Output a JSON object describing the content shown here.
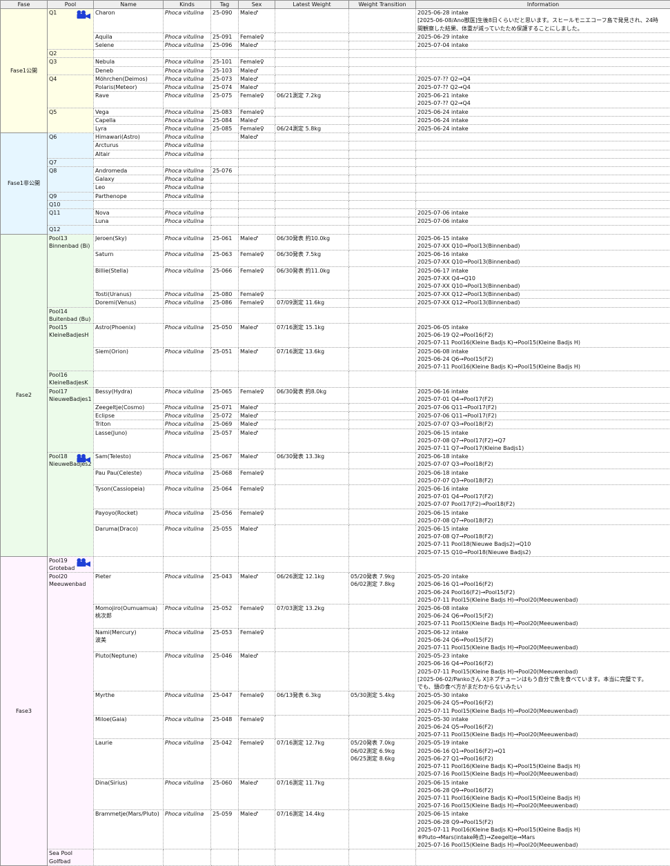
{
  "headers": [
    "Fase",
    "Pool",
    "Name",
    "Kinds",
    "Tag",
    "Sex",
    "Latest Weight",
    "Weight Transition",
    "Information"
  ],
  "colors": {
    "fase1_public": "#ffffe6",
    "fase1_private": "#e6f6ff",
    "fase2": "#ecfbea",
    "fase3": "#fff4ff",
    "camera_icon": "#1f3fd6"
  },
  "groups": [
    {
      "fase": "Fase1\n公開",
      "cls": "f1a",
      "pools": [
        {
          "pool": "Q1",
          "camera": true,
          "rows": [
            {
              "name": "Charon",
              "kind": "Phoca vitulina",
              "tag": "25-090",
              "sex": "Male♂",
              "weight": "",
              "trans": "",
              "info": "2025-06-28 intake\n[2025-06-08/Ano獣医]生後8日くらいだと思います。スヒールモニエコーフ島で発見され、24時\n間観察した結果、体重が減っていたため保護することにしました。"
            },
            {
              "name": "Aquila",
              "kind": "Phoca vitulina",
              "tag": "25-091",
              "sex": "Female♀",
              "weight": "",
              "trans": "",
              "info": "2025-06-29 intake"
            },
            {
              "name": "Selene",
              "kind": "Phoca vitulina",
              "tag": "25-096",
              "sex": "Male♂",
              "weight": "",
              "trans": "",
              "info": "2025-07-04 intake"
            }
          ]
        },
        {
          "pool": "Q2",
          "rows": [
            {
              "name": "",
              "kind": "",
              "tag": "",
              "sex": "",
              "weight": "",
              "trans": "",
              "info": ""
            }
          ]
        },
        {
          "pool": "Q3",
          "rows": [
            {
              "name": "Nebula",
              "kind": "Phoca vitulina",
              "tag": "25-101",
              "sex": "Female♀",
              "weight": "",
              "trans": "",
              "info": ""
            },
            {
              "name": "Deneb",
              "kind": "Phoca vitulina",
              "tag": "25-103",
              "sex": "Male♂",
              "weight": "",
              "trans": "",
              "info": ""
            }
          ]
        },
        {
          "pool": "Q4",
          "rows": [
            {
              "name": "Möhrchen(Deimos)",
              "kind": "Phoca vitulina",
              "tag": "25-073",
              "sex": "Male♂",
              "weight": "",
              "trans": "",
              "info": "2025-07-?? Q2→Q4"
            },
            {
              "name": "Polaris(Meteor)",
              "kind": "Phoca vitulina",
              "tag": "25-074",
              "sex": "Male♂",
              "weight": "",
              "trans": "",
              "info": "2025-07-?? Q2→Q4"
            },
            {
              "name": "Rave",
              "kind": "Phoca vitulina",
              "tag": "25-075",
              "sex": "Female♀",
              "weight": "06/21測定 7.2kg",
              "trans": "",
              "info": "2025-06-21 intake\n2025-07-?? Q2→Q4"
            }
          ]
        },
        {
          "pool": "Q5",
          "rows": [
            {
              "name": "Vega",
              "kind": "Phoca vitulina",
              "tag": "25-083",
              "sex": "Female♀",
              "weight": "",
              "trans": "",
              "info": "2025-06-24 intake"
            },
            {
              "name": "Capella",
              "kind": "Phoca vitulina",
              "tag": "25-084",
              "sex": "Male♂",
              "weight": "",
              "trans": "",
              "info": "2025-06-24 intake"
            },
            {
              "name": "Lyra",
              "kind": "Phoca vitulina",
              "tag": "25-085",
              "sex": "Female♀",
              "weight": "06/24測定 5.8kg",
              "trans": "",
              "info": "2025-06-24 intake"
            }
          ]
        }
      ]
    },
    {
      "fase": "Fase1非公開",
      "cls": "f1b",
      "pools": [
        {
          "pool": "Q6",
          "rows": [
            {
              "name": "Himawari(Astro)",
              "kind": "Phoca vitulina",
              "tag": "",
              "sex": "Male♂",
              "weight": "",
              "trans": "",
              "info": ""
            },
            {
              "name": "Arcturus",
              "kind": "Phoca vitulina",
              "tag": "",
              "sex": "",
              "weight": "",
              "trans": "",
              "info": ""
            },
            {
              "name": "Altair",
              "kind": "Phoca vitulina",
              "tag": "",
              "sex": "",
              "weight": "",
              "trans": "",
              "info": ""
            }
          ]
        },
        {
          "pool": "Q7",
          "rows": [
            {
              "name": "",
              "kind": "",
              "tag": "",
              "sex": "",
              "weight": "",
              "trans": "",
              "info": ""
            }
          ]
        },
        {
          "pool": "Q8",
          "rows": [
            {
              "name": "Andromeda",
              "kind": "Phoca vitulina",
              "tag": "25-076",
              "sex": "",
              "weight": "",
              "trans": "",
              "info": ""
            },
            {
              "name": "Galaxy",
              "kind": "Phoca vitulina",
              "tag": "",
              "sex": "",
              "weight": "",
              "trans": "",
              "info": ""
            },
            {
              "name": "Leo",
              "kind": "Phoca vitulina",
              "tag": "",
              "sex": "",
              "weight": "",
              "trans": "",
              "info": ""
            }
          ]
        },
        {
          "pool": "Q9",
          "rows": [
            {
              "name": "Parthenope",
              "kind": "Phoca vitulina",
              "tag": "",
              "sex": "",
              "weight": "",
              "trans": "",
              "info": ""
            }
          ]
        },
        {
          "pool": "Q10",
          "rows": [
            {
              "name": "",
              "kind": "",
              "tag": "",
              "sex": "",
              "weight": "",
              "trans": "",
              "info": ""
            }
          ]
        },
        {
          "pool": "Q11",
          "rows": [
            {
              "name": "Nova",
              "kind": "Phoca vitulina",
              "tag": "",
              "sex": "",
              "weight": "",
              "trans": "",
              "info": "2025-07-06 intake"
            },
            {
              "name": "Luna",
              "kind": "Phoca vitulina",
              "tag": "",
              "sex": "",
              "weight": "",
              "trans": "",
              "info": "2025-07-06 intake"
            }
          ]
        },
        {
          "pool": "Q12",
          "rows": [
            {
              "name": "",
              "kind": "",
              "tag": "",
              "sex": "",
              "weight": "",
              "trans": "",
              "info": ""
            }
          ]
        }
      ]
    },
    {
      "fase": "Fase2",
      "cls": "f2",
      "pools": [
        {
          "pool": "Pool13\nBinnenbad (Bi)",
          "rows": [
            {
              "name": "Jeroen(Sky)",
              "kind": "Phoca vitulina",
              "tag": "25-061",
              "sex": "Male♂",
              "weight": "06/30発表 約10.0kg",
              "trans": "",
              "info": "2025-06-15 intake\n2025-07-XX Q10→Pool13(Binnenbad)"
            },
            {
              "name": "Saturn",
              "kind": "Phoca vitulina",
              "tag": "25-063",
              "sex": "Female♀",
              "weight": "06/30発表 7.5kg",
              "trans": "",
              "info": "2025-06-16 intake\n2025-07-XX Q10→Pool13(Binnenbad)"
            },
            {
              "name": "Billie(Stella)",
              "kind": "Phoca vitulina",
              "tag": "25-066",
              "sex": "Female♀",
              "weight": "06/30発表 約11.0kg",
              "trans": "",
              "info": "2025-06-17 intake\n2025-07-XX Q4→Q10\n2025-07-XX Q10→Pool13(Binnenbad)"
            },
            {
              "name": "Tosti(Uranus)",
              "kind": "Phoca vitulina",
              "tag": "25-080",
              "sex": "Female♀",
              "weight": "",
              "trans": "",
              "info": "2025-07-XX Q12→Pool13(Binnenbad)"
            },
            {
              "name": "Doremi(Venus)",
              "kind": "Phoca vitulina",
              "tag": "25-086",
              "sex": "Female♀",
              "weight": "07/09測定 11.6kg",
              "trans": "",
              "info": "2025-07-XX Q12→Pool13(Binnenbad)"
            }
          ]
        },
        {
          "pool": "Pool14\nBuitenbad (Bu)",
          "rows": [
            {
              "name": "",
              "kind": "",
              "tag": "",
              "sex": "",
              "weight": "",
              "trans": "",
              "info": "\n"
            }
          ]
        },
        {
          "pool": "Pool15\nKleineBadjesH",
          "rows": [
            {
              "name": "Astro(Phoenix)",
              "kind": "Phoca vitulina",
              "tag": "25-050",
              "sex": "Male♂",
              "weight": "07/16測定 15.1kg",
              "trans": "",
              "info": "2025-06-05 intake\n2025-06-19 Q2→Pool16(F2)\n2025-07-11 Pool16(Kleine Badjs K)→Pool15(Kleine Badjs H)"
            },
            {
              "name": "Siem(Orion)",
              "kind": "Phoca vitulina",
              "tag": "25-051",
              "sex": "Male♂",
              "weight": "07/16測定 13.6kg",
              "trans": "",
              "info": "2025-06-08 intake\n2025-06-24 Q6→Pool15(F2)\n2025-07-11 Pool16(Kleine Badjs K)→Pool15(Kleine Badjs H)"
            }
          ]
        },
        {
          "pool": "Pool16\nKleineBadjesK",
          "rows": [
            {
              "name": "",
              "kind": "",
              "tag": "",
              "sex": "",
              "weight": "",
              "trans": "",
              "info": "\n"
            }
          ]
        },
        {
          "pool": "Pool17\nNieuweBadjes1",
          "rows": [
            {
              "name": "Bessy(Hydra)",
              "kind": "Phoca vitulina",
              "tag": "25-065",
              "sex": "Female♀",
              "weight": "06/30発表 約8.0kg",
              "trans": "",
              "info": "2025-06-16 intake\n2025-07-01 Q4→Pool17(F2)"
            },
            {
              "name": "Zeegeltje(Cosmo)",
              "kind": "Phoca vitulina",
              "tag": "25-071",
              "sex": "Male♂",
              "weight": "",
              "trans": "",
              "info": "2025-07-06 Q11→Pool17(F2)"
            },
            {
              "name": "Eclipse",
              "kind": "Phoca vitulina",
              "tag": "25-072",
              "sex": "Male♂",
              "weight": "",
              "trans": "",
              "info": "2025-07-06 Q11→Pool17(F2)"
            },
            {
              "name": "Triton",
              "kind": "Phoca vitulina",
              "tag": "25-069",
              "sex": "Male♂",
              "weight": "",
              "trans": "",
              "info": "2025-07-07 Q3→Pool18(F2)"
            },
            {
              "name": "Lasse(Juno)",
              "kind": "Phoca vitulina",
              "tag": "25-057",
              "sex": "Male♂",
              "weight": "",
              "trans": "",
              "info": "2025-06-15 intake\n2025-07-08 Q7→Pool17(F2)→Q7\n2025-07-11 Q7→Pool17(Kleine Badjs1)"
            }
          ]
        },
        {
          "pool": "Pool18\nNieuweBadjes2",
          "camera": true,
          "rows": [
            {
              "name": "Sam(Telesto)",
              "kind": "Phoca vitulina",
              "tag": "25-067",
              "sex": "Male♂",
              "weight": "06/30発表 13.3kg",
              "trans": "",
              "info": "2025-06-18 intake\n2025-07-07 Q3→Pool18(F2)"
            },
            {
              "name": "Pau Pau(Celeste)",
              "kind": "Phoca vitulina",
              "tag": "25-068",
              "sex": "Female♀",
              "weight": "",
              "trans": "",
              "info": "2025-06-18 intake\n2025-07-07 Q3→Pool18(F2)"
            },
            {
              "name": "Tyson(Cassiopeia)",
              "kind": "Phoca vitulina",
              "tag": "25-064",
              "sex": "Female♀",
              "weight": "",
              "trans": "",
              "info": "2025-06-16 intake\n2025-07-01 Q4→Pool17(F2)\n2025-07-07 Pool17(F2)→Pool18(F2)"
            },
            {
              "name": "Payoyo(Rocket)",
              "kind": "Phoca vitulina",
              "tag": "25-056",
              "sex": "Female♀",
              "weight": "",
              "trans": "",
              "info": "2025-06-15 intake\n2025-07-08 Q7→Pool18(F2)"
            },
            {
              "name": "Daruma(Draco)",
              "kind": "Phoca vitulina",
              "tag": "25-055",
              "sex": "Male♂",
              "weight": "",
              "trans": "",
              "info": "2025-06-15 intake\n2025-07-08 Q7→Pool18(F2)\n2025-07-11 Pool18(Nieuwe Badjs2)→Q10\n2025-07-15 Q10→Pool18(Nieuwe Badjs2)"
            }
          ]
        }
      ]
    },
    {
      "fase": "Fase3",
      "cls": "f3",
      "pools": [
        {
          "pool": "Pool19\nGrotebad",
          "camera": true,
          "rows": [
            {
              "name": "",
              "kind": "",
              "tag": "",
              "sex": "",
              "weight": "",
              "trans": "",
              "info": "\n"
            }
          ]
        },
        {
          "pool": "Pool20\nMeeuwenbad",
          "rows": [
            {
              "name": "Pieter",
              "kind": "Phoca vitulina",
              "tag": "25-043",
              "sex": "Male♂",
              "weight": "06/26測定 12.1kg",
              "trans": "05/20発表 7.9kg\n06/02測定 7.8kg",
              "info": "2025-05-20 intake\n2025-06-16 Q1→Pool16(F2)\n2025-06-24 Pool16(F2)→Pool15(F2)\n2025-07-11 Pool15(Kleine Badjs H)→Pool20(Meeuwenbad)"
            },
            {
              "name": "Momojiro(Oumuamua)\n桃次郎",
              "kind": "Phoca vitulina",
              "tag": "25-052",
              "sex": "Female♀",
              "weight": "07/03測定 13.2kg",
              "trans": "",
              "info": "2025-06-08 intake\n2025-06-24 Q6→Pool15(F2)\n2025-07-11 Pool15(Kleine Badjs H)→Pool20(Meeuwenbad)"
            },
            {
              "name": "Nami(Mercury)\n波美",
              "kind": "Phoca vitulina",
              "tag": "25-053",
              "sex": "Female♀",
              "weight": "",
              "trans": "",
              "info": "2025-06-12 intake\n2025-06-24 Q6→Pool15(F2)\n2025-07-11 Pool15(Kleine Badjs H)→Pool20(Meeuwenbad)"
            },
            {
              "name": "Pluto(Neptune)",
              "kind": "Phoca vitulina",
              "tag": "25-046",
              "sex": "Male♂",
              "weight": "",
              "trans": "",
              "info": "2025-05-23 intake\n2025-06-16 Q4→Pool16(F2)\n2025-07-11 Pool15(Kleine Badjs H)→Pool20(Meeuwenbad)\n[2025-06-02/Pankoさん X]ネプチューンはもう自分で魚を食べています。本当に完璧です。\nでも、頭の食べ方がまだわからないみたい"
            },
            {
              "name": "Myrthe",
              "kind": "Phoca vitulina",
              "tag": "25-047",
              "sex": "Female♀",
              "weight": "06/13発表 6.3kg",
              "trans": "05/30測定 5.4kg",
              "info": "2025-05-30 intake\n2025-06-24 Q5→Pool16(F2)\n2025-07-11 Pool15(Kleine Badjs H)→Pool20(Meeuwenbad)"
            },
            {
              "name": "Miloe(Gaia)",
              "kind": "Phoca vitulina",
              "tag": "25-048",
              "sex": "Female♀",
              "weight": "",
              "trans": "",
              "info": "2025-05-30 intake\n2025-06-24 Q5→Pool16(F2)\n2025-07-11 Pool15(Kleine Badjs H)→Pool20(Meeuwenbad)"
            },
            {
              "name": "Laurie",
              "kind": "Phoca vitulina",
              "tag": "25-042",
              "sex": "Female♀",
              "weight": "07/16測定 12.7kg",
              "trans": "05/20発表 7.0kg\n06/02測定 6.9kg\n06/25測定 8.6kg",
              "info": "2025-05-19 intake\n2025-06-16 Q1→Pool16(F2)→Q1\n2025-06-27 Q1→Pool16(F2)\n2025-07-11 Pool16(Kleine Badjs K)→Pool15(Kleine Badjs H)\n2025-07-16 Pool15(Kleine Badjs H)→Pool20(Meeuwenbad)"
            },
            {
              "name": "Dina(Sirius)",
              "kind": "Phoca vitulina",
              "tag": "25-060",
              "sex": "Male♂",
              "weight": "07/16測定 11.7kg",
              "trans": "",
              "info": "2025-06-15 intake\n2025-06-28 Q9→Pool16(F2)\n2025-07-11 Pool16(Kleine Badjs K)→Pool15(Kleine Badjs H)\n2025-07-16 Pool15(Kleine Badjs H)→Pool20(Meeuwenbad)"
            },
            {
              "name": "Brammetje(Mars/Pluto)",
              "kind": "Phoca vitulina",
              "tag": "25-059",
              "sex": "Male♂",
              "weight": "07/16測定 14.4kg",
              "trans": "",
              "info": "2025-06-15 intake\n2025-06-28 Q9→Pool15(F2)\n2025-07-11 Pool16(Kleine Badjs K)→Pool15(Kleine Badjs H)\n※Pluto→Mars(intake時点)→Zeegeltje→Mars\n2025-07-16 Pool15(Kleine Badjs H)→Pool20(Meeuwenbad)"
            }
          ]
        },
        {
          "pool": "Sea Pool\nGolfbad",
          "rows": [
            {
              "name": "",
              "kind": "",
              "tag": "",
              "sex": "",
              "weight": "",
              "trans": "",
              "info": "\n"
            }
          ]
        }
      ]
    }
  ]
}
